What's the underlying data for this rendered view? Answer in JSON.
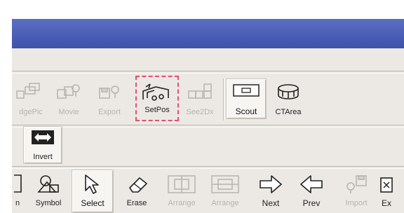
{
  "toolbar_row1": [
    {
      "key": "edgepic",
      "label": "dgePic",
      "state": "disabled",
      "icon": "edge-picture-icon"
    },
    {
      "key": "movie",
      "label": "Movie",
      "state": "disabled",
      "icon": "movie-icon"
    },
    {
      "key": "export",
      "label": "Export",
      "state": "disabled",
      "icon": "export-icon"
    },
    {
      "key": "setpos",
      "label": "SetPos",
      "state": "highlighted",
      "icon": "set-position-icon",
      "highlight_color": "#e0506c"
    },
    {
      "key": "see2dx",
      "label": "See2Dx",
      "state": "disabled",
      "icon": "see-2d-icon"
    },
    {
      "key": "scout",
      "label": "Scout",
      "state": "enabled",
      "icon": "scout-icon"
    },
    {
      "key": "ctarea",
      "label": "CTArea",
      "state": "enabled",
      "icon": "ct-area-icon"
    }
  ],
  "toolbar_row2": [
    {
      "key": "invert",
      "label": "Invert",
      "state": "enabled",
      "icon": "invert-icon"
    }
  ],
  "toolbar_row3": [
    {
      "key": "partial",
      "label": "n",
      "state": "enabled",
      "icon": "bracket-icon"
    },
    {
      "key": "symbol",
      "label": "Symbol",
      "state": "enabled",
      "icon": "symbol-icon"
    },
    {
      "key": "select",
      "label": "Select",
      "state": "active",
      "icon": "arrow-cursor-icon"
    },
    {
      "key": "erase",
      "label": "Erase",
      "state": "enabled",
      "icon": "eraser-icon"
    },
    {
      "key": "arrange1",
      "label": "Arrange",
      "state": "disabled",
      "icon": "arrange-horizontal-icon"
    },
    {
      "key": "arrange2",
      "label": "Arrange",
      "state": "disabled",
      "icon": "arrange-vertical-icon"
    },
    {
      "key": "next",
      "label": "Next",
      "state": "enabled",
      "icon": "arrow-right-icon"
    },
    {
      "key": "prev",
      "label": "Prev",
      "state": "enabled",
      "icon": "arrow-left-icon"
    },
    {
      "key": "import",
      "label": "Import",
      "state": "disabled",
      "icon": "import-icon"
    },
    {
      "key": "exit",
      "label": "Ex",
      "state": "enabled",
      "icon": "exit-icon"
    }
  ],
  "colors": {
    "titlebar": "#4a5db6",
    "panel": "#ece9e4",
    "disabled": "#b7b3ab",
    "highlight": "#e0506c"
  }
}
